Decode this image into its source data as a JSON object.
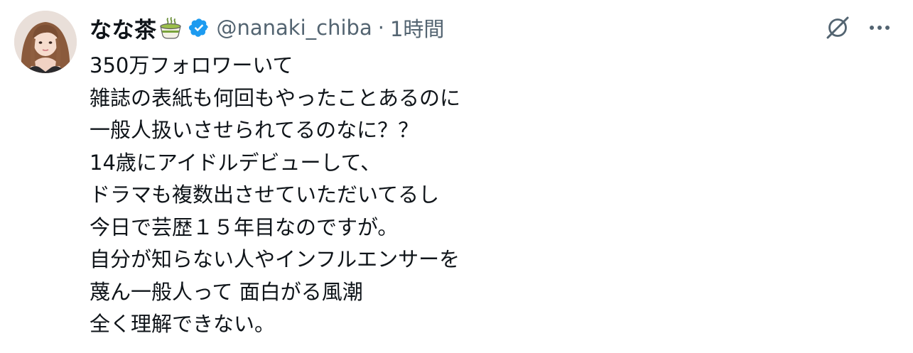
{
  "author": {
    "display_name": "なな茶",
    "name_emoji": "teacup-emoji",
    "handle": "@nanaki_chiba",
    "separator": "·",
    "timestamp": "1時間",
    "verified_color": "#1d9bf0"
  },
  "tweet": {
    "lines": [
      "350万フォロワーいて",
      "雑誌の表紙も何回もやったことあるのに",
      "一般人扱いさせられてるのなに？？",
      "14歳にアイドルデビューして、",
      "ドラマも複数出させていただいてるし",
      "今日で芸歴１５年目なのですが。",
      "自分が知らない人やインフルエンサーを",
      "蔑ん一般人って 面白がる風潮",
      "全く理解できない。"
    ]
  },
  "actions": {
    "grok_icon": "grok-icon",
    "more_icon": "more-options-icon"
  },
  "colors": {
    "text_primary": "#0f1419",
    "text_secondary": "#536471",
    "accent": "#1d9bf0"
  }
}
